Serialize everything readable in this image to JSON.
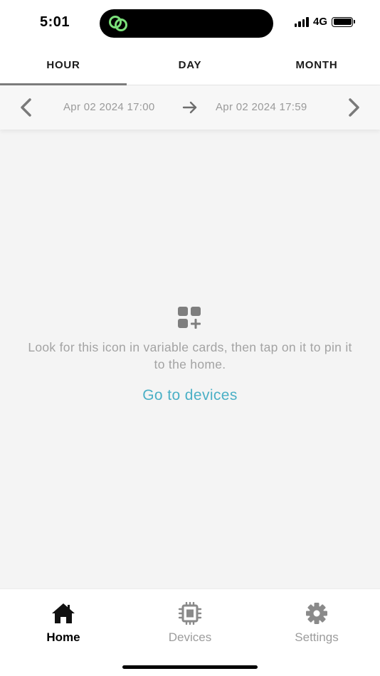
{
  "status_bar": {
    "time": "5:01",
    "network": "4G",
    "island_icon": "link-icon",
    "island_icon_color": "#7be07a"
  },
  "tabs": [
    {
      "label": "HOUR",
      "active": true
    },
    {
      "label": "DAY",
      "active": false
    },
    {
      "label": "MONTH",
      "active": false
    }
  ],
  "date_range": {
    "start": "Apr 02 2024 17:00",
    "end": "Apr 02 2024 17:59",
    "prev_icon": "chevron-left-icon",
    "next_icon": "chevron-right-icon",
    "separator_icon": "arrow-right-icon"
  },
  "empty_state": {
    "icon": "dashboard-add-icon",
    "message": "Look for this icon in variable cards, then tap on it to pin it to the home.",
    "link_label": "Go to devices",
    "link_color": "#4bb0c6"
  },
  "bottom_nav": [
    {
      "label": "Home",
      "icon": "home-icon",
      "active": true
    },
    {
      "label": "Devices",
      "icon": "chip-icon",
      "active": false
    },
    {
      "label": "Settings",
      "icon": "gear-icon",
      "active": false
    }
  ]
}
